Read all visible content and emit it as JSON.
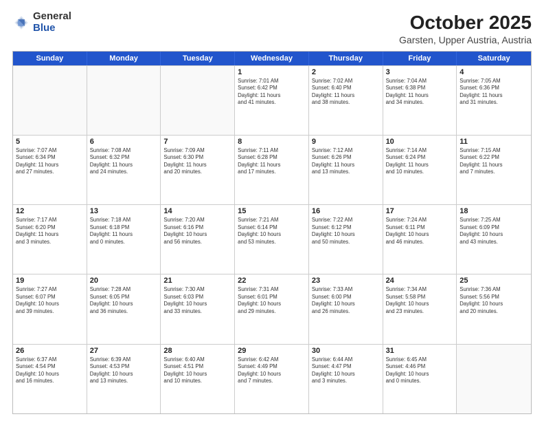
{
  "header": {
    "logo_general": "General",
    "logo_blue": "Blue",
    "title": "October 2025",
    "subtitle": "Garsten, Upper Austria, Austria"
  },
  "weekdays": [
    "Sunday",
    "Monday",
    "Tuesday",
    "Wednesday",
    "Thursday",
    "Friday",
    "Saturday"
  ],
  "rows": [
    [
      {
        "date": "",
        "info": ""
      },
      {
        "date": "",
        "info": ""
      },
      {
        "date": "",
        "info": ""
      },
      {
        "date": "1",
        "info": "Sunrise: 7:01 AM\nSunset: 6:42 PM\nDaylight: 11 hours\nand 41 minutes."
      },
      {
        "date": "2",
        "info": "Sunrise: 7:02 AM\nSunset: 6:40 PM\nDaylight: 11 hours\nand 38 minutes."
      },
      {
        "date": "3",
        "info": "Sunrise: 7:04 AM\nSunset: 6:38 PM\nDaylight: 11 hours\nand 34 minutes."
      },
      {
        "date": "4",
        "info": "Sunrise: 7:05 AM\nSunset: 6:36 PM\nDaylight: 11 hours\nand 31 minutes."
      }
    ],
    [
      {
        "date": "5",
        "info": "Sunrise: 7:07 AM\nSunset: 6:34 PM\nDaylight: 11 hours\nand 27 minutes."
      },
      {
        "date": "6",
        "info": "Sunrise: 7:08 AM\nSunset: 6:32 PM\nDaylight: 11 hours\nand 24 minutes."
      },
      {
        "date": "7",
        "info": "Sunrise: 7:09 AM\nSunset: 6:30 PM\nDaylight: 11 hours\nand 20 minutes."
      },
      {
        "date": "8",
        "info": "Sunrise: 7:11 AM\nSunset: 6:28 PM\nDaylight: 11 hours\nand 17 minutes."
      },
      {
        "date": "9",
        "info": "Sunrise: 7:12 AM\nSunset: 6:26 PM\nDaylight: 11 hours\nand 13 minutes."
      },
      {
        "date": "10",
        "info": "Sunrise: 7:14 AM\nSunset: 6:24 PM\nDaylight: 11 hours\nand 10 minutes."
      },
      {
        "date": "11",
        "info": "Sunrise: 7:15 AM\nSunset: 6:22 PM\nDaylight: 11 hours\nand 7 minutes."
      }
    ],
    [
      {
        "date": "12",
        "info": "Sunrise: 7:17 AM\nSunset: 6:20 PM\nDaylight: 11 hours\nand 3 minutes."
      },
      {
        "date": "13",
        "info": "Sunrise: 7:18 AM\nSunset: 6:18 PM\nDaylight: 11 hours\nand 0 minutes."
      },
      {
        "date": "14",
        "info": "Sunrise: 7:20 AM\nSunset: 6:16 PM\nDaylight: 10 hours\nand 56 minutes."
      },
      {
        "date": "15",
        "info": "Sunrise: 7:21 AM\nSunset: 6:14 PM\nDaylight: 10 hours\nand 53 minutes."
      },
      {
        "date": "16",
        "info": "Sunrise: 7:22 AM\nSunset: 6:12 PM\nDaylight: 10 hours\nand 50 minutes."
      },
      {
        "date": "17",
        "info": "Sunrise: 7:24 AM\nSunset: 6:11 PM\nDaylight: 10 hours\nand 46 minutes."
      },
      {
        "date": "18",
        "info": "Sunrise: 7:25 AM\nSunset: 6:09 PM\nDaylight: 10 hours\nand 43 minutes."
      }
    ],
    [
      {
        "date": "19",
        "info": "Sunrise: 7:27 AM\nSunset: 6:07 PM\nDaylight: 10 hours\nand 39 minutes."
      },
      {
        "date": "20",
        "info": "Sunrise: 7:28 AM\nSunset: 6:05 PM\nDaylight: 10 hours\nand 36 minutes."
      },
      {
        "date": "21",
        "info": "Sunrise: 7:30 AM\nSunset: 6:03 PM\nDaylight: 10 hours\nand 33 minutes."
      },
      {
        "date": "22",
        "info": "Sunrise: 7:31 AM\nSunset: 6:01 PM\nDaylight: 10 hours\nand 29 minutes."
      },
      {
        "date": "23",
        "info": "Sunrise: 7:33 AM\nSunset: 6:00 PM\nDaylight: 10 hours\nand 26 minutes."
      },
      {
        "date": "24",
        "info": "Sunrise: 7:34 AM\nSunset: 5:58 PM\nDaylight: 10 hours\nand 23 minutes."
      },
      {
        "date": "25",
        "info": "Sunrise: 7:36 AM\nSunset: 5:56 PM\nDaylight: 10 hours\nand 20 minutes."
      }
    ],
    [
      {
        "date": "26",
        "info": "Sunrise: 6:37 AM\nSunset: 4:54 PM\nDaylight: 10 hours\nand 16 minutes."
      },
      {
        "date": "27",
        "info": "Sunrise: 6:39 AM\nSunset: 4:53 PM\nDaylight: 10 hours\nand 13 minutes."
      },
      {
        "date": "28",
        "info": "Sunrise: 6:40 AM\nSunset: 4:51 PM\nDaylight: 10 hours\nand 10 minutes."
      },
      {
        "date": "29",
        "info": "Sunrise: 6:42 AM\nSunset: 4:49 PM\nDaylight: 10 hours\nand 7 minutes."
      },
      {
        "date": "30",
        "info": "Sunrise: 6:44 AM\nSunset: 4:47 PM\nDaylight: 10 hours\nand 3 minutes."
      },
      {
        "date": "31",
        "info": "Sunrise: 6:45 AM\nSunset: 4:46 PM\nDaylight: 10 hours\nand 0 minutes."
      },
      {
        "date": "",
        "info": ""
      }
    ]
  ]
}
